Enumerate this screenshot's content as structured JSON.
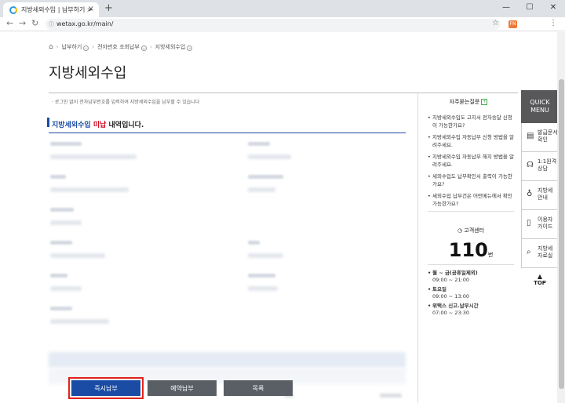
{
  "browser": {
    "tab_title": "지방세외수입 | 납부하기 > 전자",
    "tab_close": "×",
    "new_tab": "+",
    "url": "wetax.go.kr/main/",
    "ext_badge": "FN",
    "win_minimize": "—",
    "win_maximize": "☐",
    "win_close": "✕"
  },
  "breadcrumb": [
    "납부하기",
    "전자번호 조회납부",
    "지방세외수입"
  ],
  "page_title": "지방세외수입",
  "notice": "· 로그인 없이 전자납부번호를 입력하여 지방세외수입을 납부할 수 있습니다",
  "section": {
    "blue": "지방세외수입",
    "red": "미납",
    "rest": "내역입니다."
  },
  "buttons": {
    "pay_now": "즉시납부",
    "reserve_pay": "예약납부",
    "list": "목록"
  },
  "faq": {
    "title": "자주묻는질문",
    "plus": "+",
    "items": [
      "지방세외수입도 고지서 전자송달 신청이 가능한가요?",
      "지방세외수입 자동납부 신청 방법을 알려주세요.",
      "지방세외수입 자동납부 해지 방법을 알려주세요.",
      "세외수입도 납부확인서 출력이 가능한가요?",
      "세외수입 납부건은 어떤메뉴에서 확인가능한가요?"
    ]
  },
  "customer_center": {
    "title": "고객센터",
    "number": "110",
    "number_suffix": "번",
    "hours": [
      {
        "label": "월 ~ 금(공휴일제외)",
        "time": "09:00 ~ 21:00"
      },
      {
        "label": "토요일",
        "time": "09:00 ~ 13:00"
      },
      {
        "label": "위택스 신고.납부시간",
        "time": "07:00 ~ 23:30"
      }
    ]
  },
  "quick_menu": {
    "title": "QUICK MENU",
    "items": [
      {
        "label": "발급문서 확인"
      },
      {
        "label": "1:1원격 상담"
      },
      {
        "label": "지방세 안내"
      },
      {
        "label": "이용자 가이드"
      },
      {
        "label": "지방세 자료실"
      }
    ],
    "top": "TOP"
  },
  "icons": {
    "home": "home-icon",
    "lock": "lock-icon",
    "star": "star-icon"
  }
}
